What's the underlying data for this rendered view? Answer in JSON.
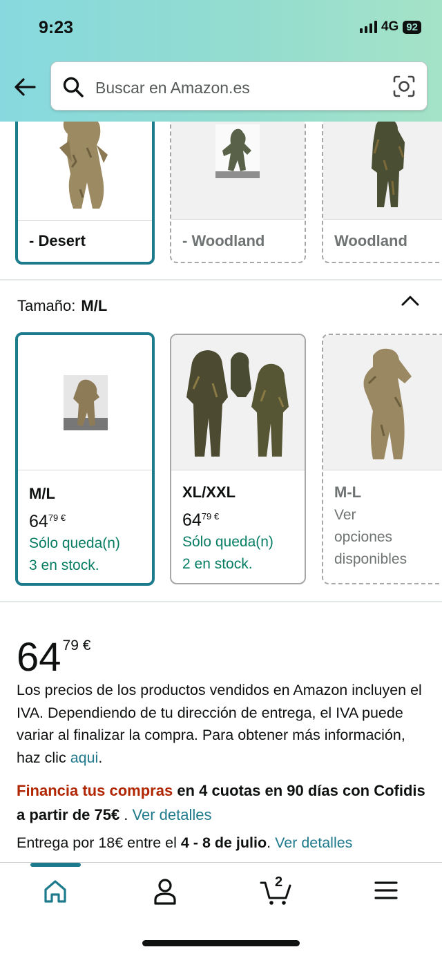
{
  "status": {
    "time": "9:23",
    "network": "4G",
    "battery": "92"
  },
  "search": {
    "placeholder": "Buscar en Amazon.es"
  },
  "style_swatches": [
    {
      "label": "- Desert",
      "selected": true
    },
    {
      "label": "- Woodland",
      "selected": false
    },
    {
      "label": "Woodland",
      "selected": false
    }
  ],
  "size": {
    "label": "Tamaño:",
    "selected": "M/L",
    "options": [
      {
        "label": "M/L",
        "price_whole": "64",
        "price_frac": "79 €",
        "stock_line1": "Sólo queda(n)",
        "stock_line2": "3 en stock."
      },
      {
        "label": "XL/XXL",
        "price_whole": "64",
        "price_frac": "79 €",
        "stock_line1": "Sólo queda(n)",
        "stock_line2": "2 en stock."
      },
      {
        "label": "M-L",
        "line1": "Ver",
        "line2": "opciones",
        "line3": "disponibles"
      }
    ]
  },
  "price": {
    "whole": "64",
    "frac": "79 €"
  },
  "tax": {
    "text": "Los precios de los productos vendidos en Amazon incluyen el IVA. Dependiendo de tu dirección de entrega, el IVA puede variar al finalizar la compra. Para obtener más información, haz clic",
    "link": "aqui",
    "end": "."
  },
  "finance": {
    "red": "Financia tus compras",
    "bold": "en 4 cuotas en 90 días con Cofidis a partir de 75€",
    "sep": " . ",
    "link": "Ver detalles"
  },
  "delivery": {
    "prefix": "Entrega por 18€ entre el",
    "dates": "4 - 8 de julio",
    "sep": ". ",
    "link": "Ver detalles"
  },
  "nav": {
    "cart_count": "2"
  },
  "colors": {
    "accent": "#1c7b8c",
    "link": "#1f7a8c",
    "stock_green": "#067d62",
    "finance_red": "#b12704"
  }
}
